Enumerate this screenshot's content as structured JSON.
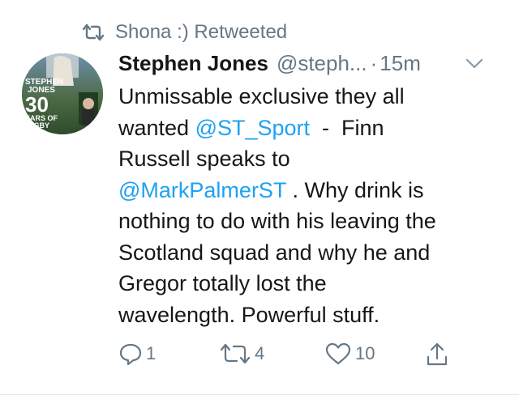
{
  "retweet": {
    "icon": "retweet-icon",
    "label": "Shona :) Retweeted"
  },
  "tweet": {
    "avatar_text": {
      "line1": "STEPHEN",
      "line2": "JONES",
      "number": "30",
      "line3": "EARS OF",
      "line4": "UGBY"
    },
    "author_name": "Stephen Jones",
    "handle": "@steph...",
    "separator": "·",
    "time": "15m",
    "body": {
      "line1": "Unmissable exclusive they all",
      "line2_prefix": "wanted ",
      "mention1": "@ST_Sport",
      "line2_suffix": "  -  Finn",
      "line3": "Russell speaks to",
      "mention2": "@MarkPalmerST",
      "line4_suffix": " . Why drink is",
      "line5": "nothing to do with his leaving the",
      "line6": "Scotland squad and why he and",
      "line7": "Gregor totally lost the",
      "line8": "wavelength. Powerful stuff."
    },
    "actions": {
      "reply_count": "1",
      "retweet_count": "4",
      "like_count": "10"
    }
  },
  "colors": {
    "text": "#14171a",
    "secondary": "#657786",
    "link": "#1da1f2",
    "border": "#e1e8ed"
  }
}
